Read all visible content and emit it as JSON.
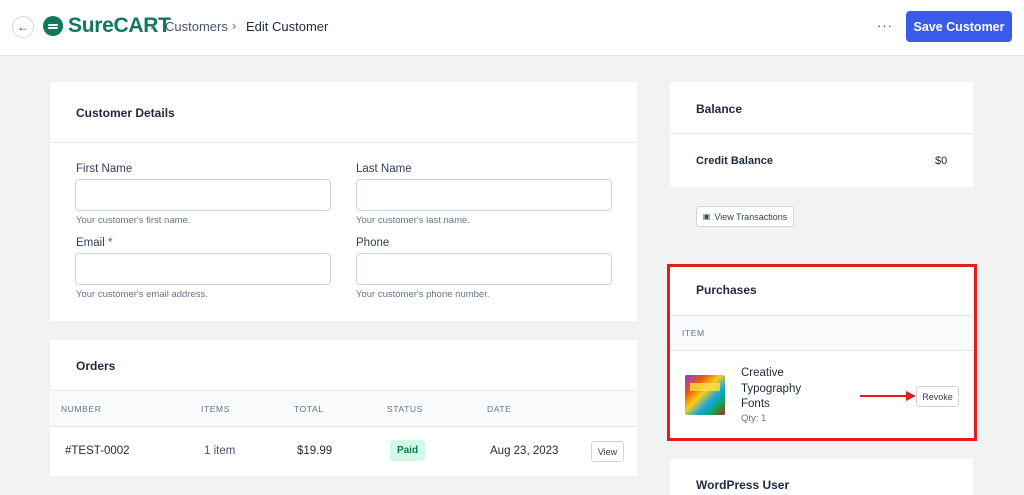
{
  "header": {
    "back_icon": "arrow-left-icon",
    "logo_text": "SureCART",
    "breadcrumb": [
      "Customers",
      "Edit Customer"
    ],
    "more_label": "···",
    "save_label": "Save Customer"
  },
  "customer_details": {
    "title": "Customer Details",
    "first_name": {
      "label": "First Name",
      "value": "",
      "help": "Your customer's first name."
    },
    "last_name": {
      "label": "Last Name",
      "value": "",
      "help": "Your customer's last name."
    },
    "email": {
      "label": "Email",
      "required": "*",
      "value": "",
      "help": "Your customer's email address."
    },
    "phone": {
      "label": "Phone",
      "value": "",
      "help": "Your customer's phone number."
    }
  },
  "orders": {
    "title": "Orders",
    "columns": [
      "NUMBER",
      "ITEMS",
      "TOTAL",
      "STATUS",
      "DATE"
    ],
    "rows": [
      {
        "number": "#TEST-0002",
        "items": "1 item",
        "total": "$19.99",
        "status": "Paid",
        "date": "Aug 23, 2023",
        "action": "View"
      }
    ]
  },
  "balance": {
    "title": "Balance",
    "credit_label": "Credit Balance",
    "credit_value": "$0",
    "view_transactions": "View Transactions"
  },
  "purchases": {
    "title": "Purchases",
    "column": "ITEM",
    "items": [
      {
        "name_lines": [
          "Creative",
          "Typography",
          "Fonts"
        ],
        "qty": "Qty: 1",
        "action": "Revoke"
      }
    ],
    "highlight_color": "#e11d1d"
  },
  "wordpress_user": {
    "title": "WordPress User"
  },
  "colors": {
    "brand": "#0f7a5a",
    "primary": "#3a5ae8",
    "paid_bg": "#d1fae5",
    "paid_text": "#047857"
  }
}
